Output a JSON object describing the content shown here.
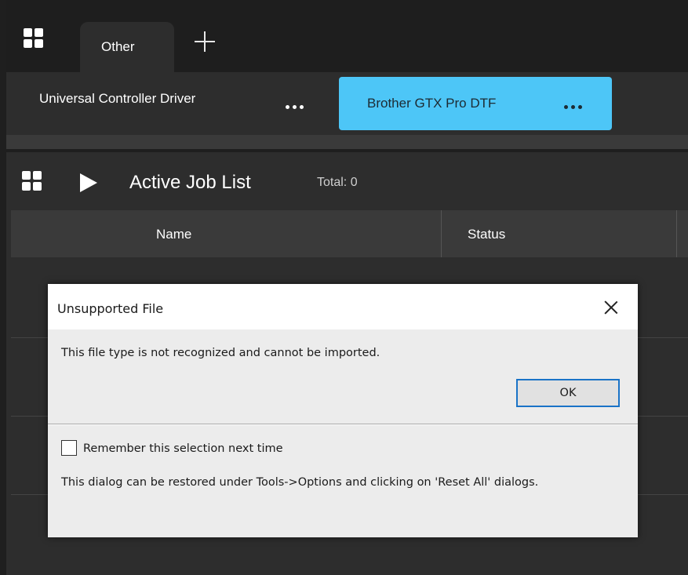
{
  "tabs": {
    "active_tab": "Other",
    "icons": {
      "apps": "grid-icon",
      "add_tab": "plus-icon"
    }
  },
  "devices": {
    "items": [
      {
        "label": "Universal Controller Driver",
        "selected": false
      },
      {
        "label": "Brother GTX Pro DTF",
        "selected": true
      }
    ],
    "selected_color": "#4dc6f7"
  },
  "job_list": {
    "title": "Active Job List",
    "total": "Total: 0",
    "columns": [
      "Name",
      "Status"
    ]
  },
  "dialog": {
    "title": "Unsupported File",
    "message": "This file type is not recognized and cannot be imported.",
    "ok_label": "OK",
    "checkbox_label": "Remember this selection next time",
    "checkbox_checked": false,
    "note": "This dialog can be restored under Tools->Options and clicking on 'Reset All' dialogs."
  }
}
